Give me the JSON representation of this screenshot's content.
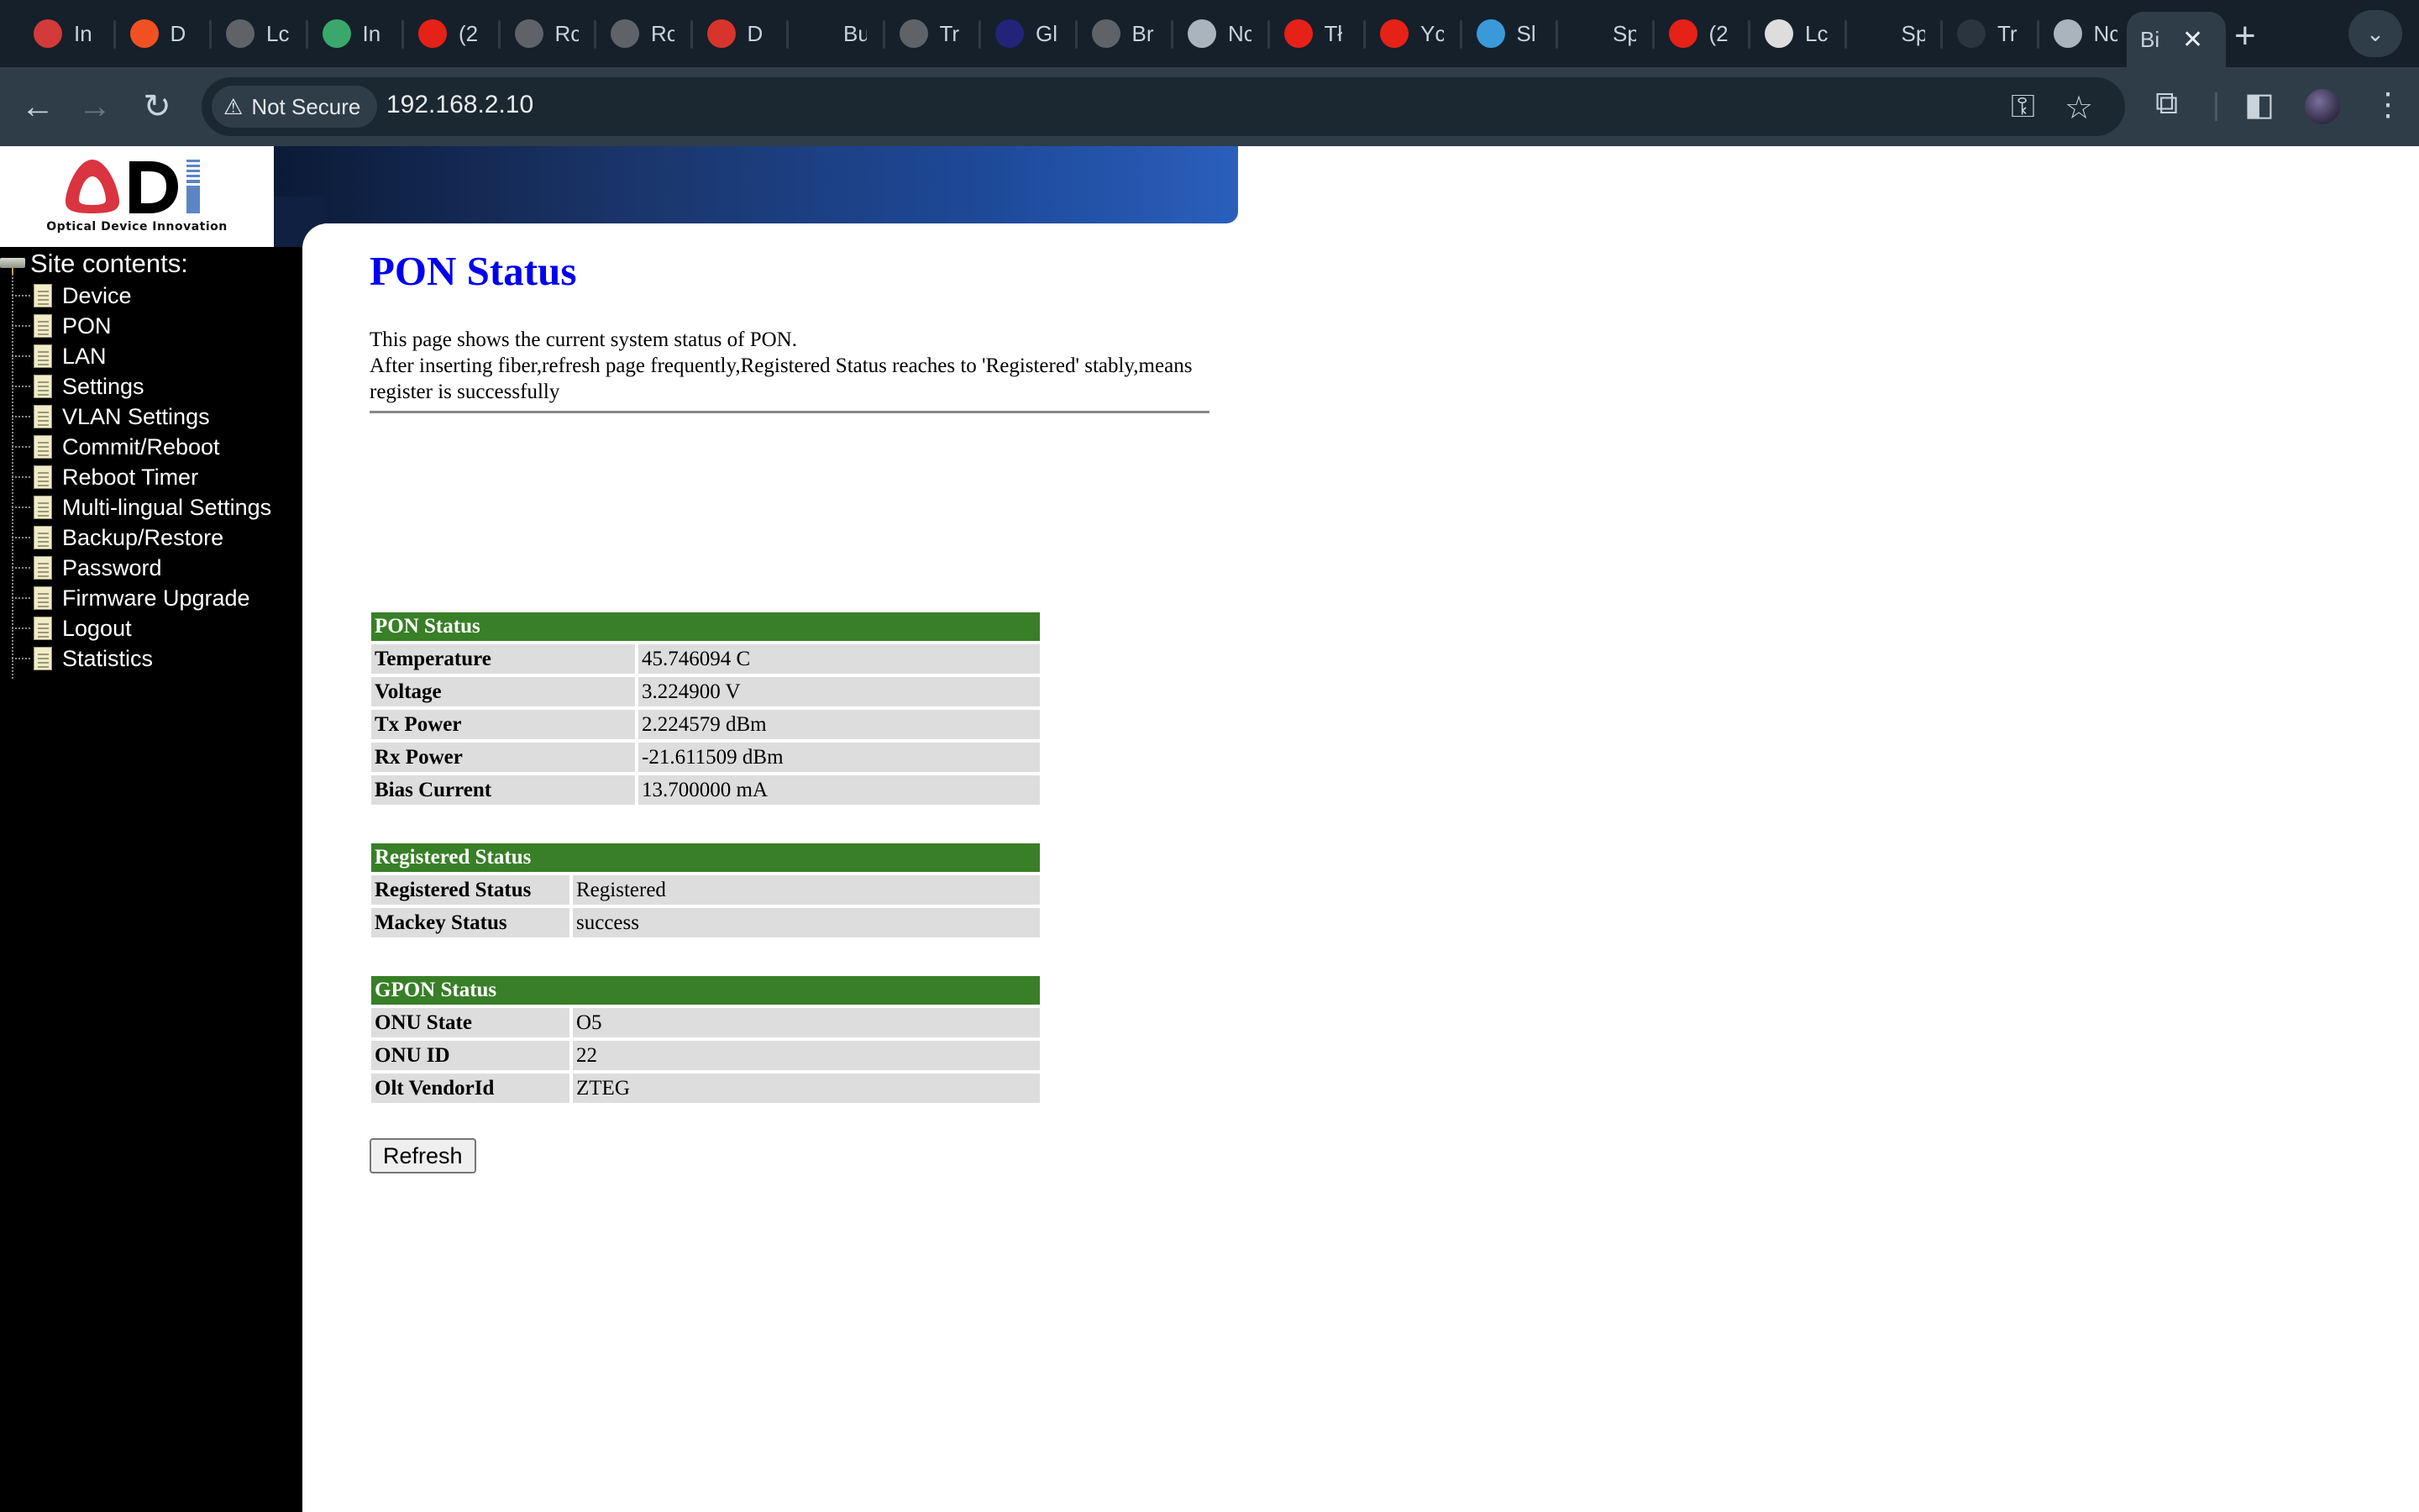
{
  "browser": {
    "tabs": [
      {
        "title": "In",
        "icon": "gauge-icon",
        "color": "#d33a3a"
      },
      {
        "title": "D",
        "icon": "microsoft-icon",
        "color": "#f25022"
      },
      {
        "title": "Lc",
        "icon": "globe-icon",
        "color": "#5f6368"
      },
      {
        "title": "In",
        "icon": "app-icon",
        "color": "#3aa86b"
      },
      {
        "title": "(2",
        "icon": "youtube-icon",
        "color": "#e62117"
      },
      {
        "title": "Rc",
        "icon": "globe-icon",
        "color": "#5f6368"
      },
      {
        "title": "Rc",
        "icon": "globe-icon",
        "color": "#5f6368"
      },
      {
        "title": "D",
        "icon": "huawei-icon",
        "color": "#d9342b"
      },
      {
        "title": "Bu",
        "icon": "ib-icon",
        "color": "#15202a"
      },
      {
        "title": "Tr",
        "icon": "globe-icon",
        "color": "#5f6368"
      },
      {
        "title": "Gl",
        "icon": "ampersand-icon",
        "color": "#23237a"
      },
      {
        "title": "Br",
        "icon": "globe-icon",
        "color": "#5f6368"
      },
      {
        "title": "Nc",
        "icon": "chrome-icon",
        "color": "#aab4bd"
      },
      {
        "title": "Tł",
        "icon": "youtube-icon",
        "color": "#e62117"
      },
      {
        "title": "Yc",
        "icon": "youtube-music-icon",
        "color": "#e62117"
      },
      {
        "title": "Sl",
        "icon": "box-icon",
        "color": "#3a9ad9"
      },
      {
        "title": "Sp",
        "icon": "speedometer-icon",
        "color": "#15202a"
      },
      {
        "title": "(2",
        "icon": "youtube-icon",
        "color": "#e62117"
      },
      {
        "title": "Lc",
        "icon": "camera-icon",
        "color": "#dddddd"
      },
      {
        "title": "Sp",
        "icon": "speedometer-icon",
        "color": "#15202a"
      },
      {
        "title": "Tr",
        "icon": "generic-icon",
        "color": "#2a3540"
      },
      {
        "title": "Nc",
        "icon": "chrome-icon",
        "color": "#aab4bd"
      }
    ],
    "active_tab": {
      "title": "Bi",
      "close": "✕"
    },
    "new_tab": "+",
    "tab_menu": "⌄",
    "back": "←",
    "forward": "→",
    "reload": "↻",
    "security_label": "Not Secure",
    "security_icon": "⚠",
    "url": "192.168.2.10",
    "key_icon": "⚿",
    "star_icon": "☆",
    "extensions_icon": "⧉",
    "sidepanel_icon": "◧",
    "menu_icon": "⋮"
  },
  "logo": {
    "tagline": "Optical Device Innovation",
    "colors": {
      "o": "#d9343f",
      "d": "#000000",
      "i": "#5b86c5"
    }
  },
  "sidebar": {
    "root_label": "Site contents:",
    "items": [
      {
        "label": "Device"
      },
      {
        "label": "PON"
      },
      {
        "label": "LAN"
      },
      {
        "label": "Settings"
      },
      {
        "label": "VLAN Settings"
      },
      {
        "label": "Commit/Reboot"
      },
      {
        "label": "Reboot Timer"
      },
      {
        "label": "Multi-lingual Settings"
      },
      {
        "label": "Backup/Restore"
      },
      {
        "label": "Password"
      },
      {
        "label": "Firmware Upgrade"
      },
      {
        "label": "Logout"
      },
      {
        "label": "Statistics"
      }
    ]
  },
  "main": {
    "title": "PON Status",
    "intro_line1": "This page shows the current system status of PON.",
    "intro_line2": "After inserting fiber,refresh page frequently,Registered Status reaches to 'Registered' stably,means register is successfully",
    "pon_status": {
      "header": "PON Status",
      "rows": [
        {
          "key": "Temperature",
          "value": "45.746094 C"
        },
        {
          "key": "Voltage",
          "value": "3.224900 V"
        },
        {
          "key": "Tx Power",
          "value": "2.224579 dBm"
        },
        {
          "key": "Rx Power",
          "value": "-21.611509 dBm"
        },
        {
          "key": "Bias Current",
          "value": "13.700000 mA"
        }
      ]
    },
    "registered_status": {
      "header": "Registered Status",
      "rows": [
        {
          "key": "Registered Status",
          "value": "Registered"
        },
        {
          "key": "Mackey Status",
          "value": "success"
        }
      ]
    },
    "gpon_status": {
      "header": "GPON Status",
      "rows": [
        {
          "key": "ONU State",
          "value": "O5"
        },
        {
          "key": "ONU ID",
          "value": "22"
        },
        {
          "key": "Olt VendorId",
          "value": "ZTEG"
        }
      ]
    },
    "refresh_label": "Refresh",
    "header_color": "#387f27",
    "title_color": "#0000ee"
  }
}
